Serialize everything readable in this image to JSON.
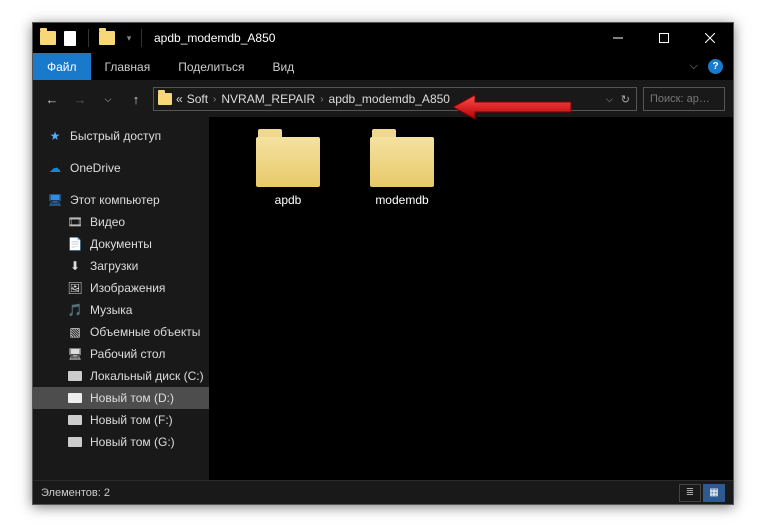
{
  "title": "apdb_modemdb_A850",
  "ribbon": {
    "file": "Файл",
    "home": "Главная",
    "share": "Поделиться",
    "view": "Вид"
  },
  "breadcrumbs": {
    "prefix": "«",
    "items": [
      "Soft",
      "NVRAM_REPAIR",
      "apdb_modemdb_A850"
    ]
  },
  "search_placeholder": "Поиск: ap…",
  "sidebar": {
    "quick": "Быстрый доступ",
    "onedrive": "OneDrive",
    "thispc": "Этот компьютер",
    "items": [
      "Видео",
      "Документы",
      "Загрузки",
      "Изображения",
      "Музыка",
      "Объемные объекты",
      "Рабочий стол",
      "Локальный диск (C:)",
      "Новый том (D:)",
      "Новый том (F:)",
      "Новый том (G:)"
    ],
    "selected_index": 8
  },
  "files": [
    {
      "name": "apdb"
    },
    {
      "name": "modemdb"
    }
  ],
  "status": {
    "count_label": "Элементов: 2"
  }
}
